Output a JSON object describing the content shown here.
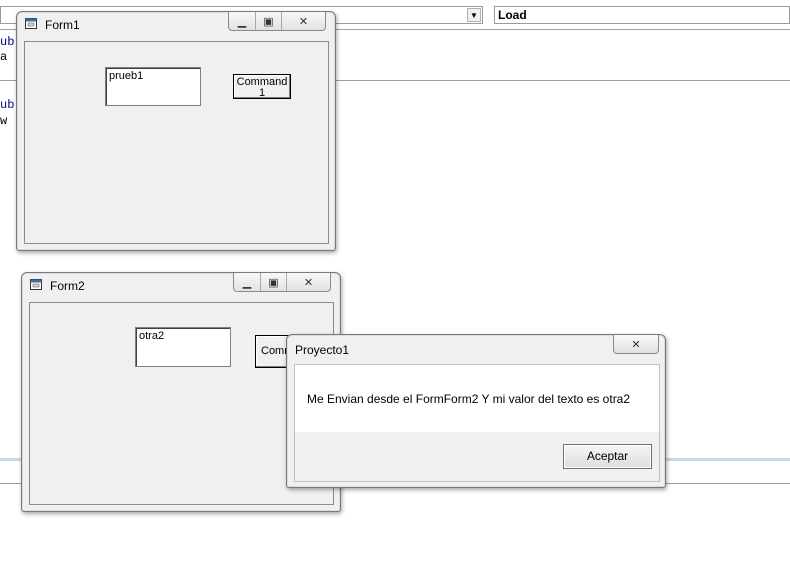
{
  "ide": {
    "object_combo_value": "",
    "procedure_combo_value": "Load",
    "code_fragments": [
      "ub",
      "a",
      "ub",
      "w"
    ]
  },
  "form1": {
    "title": "Form1",
    "textbox_value": "prueb1",
    "button_label": "Command\n1"
  },
  "form2": {
    "title": "Form2",
    "textbox_value": "otra2",
    "button_label": "Comm"
  },
  "msgbox": {
    "title": "Proyecto1",
    "message": "Me Envian desde el FormForm2 Y mi valor del texto es otra2",
    "ok_label": "Aceptar"
  }
}
